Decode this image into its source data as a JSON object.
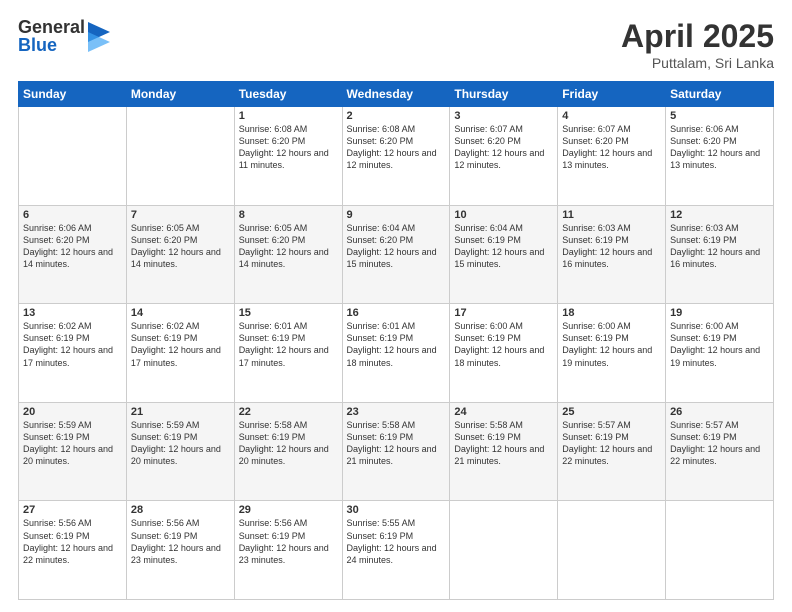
{
  "logo": {
    "general": "General",
    "blue": "Blue"
  },
  "title": {
    "month_year": "April 2025",
    "location": "Puttalam, Sri Lanka"
  },
  "headers": [
    "Sunday",
    "Monday",
    "Tuesday",
    "Wednesday",
    "Thursday",
    "Friday",
    "Saturday"
  ],
  "weeks": [
    [
      {
        "day": "",
        "info": ""
      },
      {
        "day": "",
        "info": ""
      },
      {
        "day": "1",
        "info": "Sunrise: 6:08 AM\nSunset: 6:20 PM\nDaylight: 12 hours and 11 minutes."
      },
      {
        "day": "2",
        "info": "Sunrise: 6:08 AM\nSunset: 6:20 PM\nDaylight: 12 hours and 12 minutes."
      },
      {
        "day": "3",
        "info": "Sunrise: 6:07 AM\nSunset: 6:20 PM\nDaylight: 12 hours and 12 minutes."
      },
      {
        "day": "4",
        "info": "Sunrise: 6:07 AM\nSunset: 6:20 PM\nDaylight: 12 hours and 13 minutes."
      },
      {
        "day": "5",
        "info": "Sunrise: 6:06 AM\nSunset: 6:20 PM\nDaylight: 12 hours and 13 minutes."
      }
    ],
    [
      {
        "day": "6",
        "info": "Sunrise: 6:06 AM\nSunset: 6:20 PM\nDaylight: 12 hours and 14 minutes."
      },
      {
        "day": "7",
        "info": "Sunrise: 6:05 AM\nSunset: 6:20 PM\nDaylight: 12 hours and 14 minutes."
      },
      {
        "day": "8",
        "info": "Sunrise: 6:05 AM\nSunset: 6:20 PM\nDaylight: 12 hours and 14 minutes."
      },
      {
        "day": "9",
        "info": "Sunrise: 6:04 AM\nSunset: 6:20 PM\nDaylight: 12 hours and 15 minutes."
      },
      {
        "day": "10",
        "info": "Sunrise: 6:04 AM\nSunset: 6:19 PM\nDaylight: 12 hours and 15 minutes."
      },
      {
        "day": "11",
        "info": "Sunrise: 6:03 AM\nSunset: 6:19 PM\nDaylight: 12 hours and 16 minutes."
      },
      {
        "day": "12",
        "info": "Sunrise: 6:03 AM\nSunset: 6:19 PM\nDaylight: 12 hours and 16 minutes."
      }
    ],
    [
      {
        "day": "13",
        "info": "Sunrise: 6:02 AM\nSunset: 6:19 PM\nDaylight: 12 hours and 17 minutes."
      },
      {
        "day": "14",
        "info": "Sunrise: 6:02 AM\nSunset: 6:19 PM\nDaylight: 12 hours and 17 minutes."
      },
      {
        "day": "15",
        "info": "Sunrise: 6:01 AM\nSunset: 6:19 PM\nDaylight: 12 hours and 17 minutes."
      },
      {
        "day": "16",
        "info": "Sunrise: 6:01 AM\nSunset: 6:19 PM\nDaylight: 12 hours and 18 minutes."
      },
      {
        "day": "17",
        "info": "Sunrise: 6:00 AM\nSunset: 6:19 PM\nDaylight: 12 hours and 18 minutes."
      },
      {
        "day": "18",
        "info": "Sunrise: 6:00 AM\nSunset: 6:19 PM\nDaylight: 12 hours and 19 minutes."
      },
      {
        "day": "19",
        "info": "Sunrise: 6:00 AM\nSunset: 6:19 PM\nDaylight: 12 hours and 19 minutes."
      }
    ],
    [
      {
        "day": "20",
        "info": "Sunrise: 5:59 AM\nSunset: 6:19 PM\nDaylight: 12 hours and 20 minutes."
      },
      {
        "day": "21",
        "info": "Sunrise: 5:59 AM\nSunset: 6:19 PM\nDaylight: 12 hours and 20 minutes."
      },
      {
        "day": "22",
        "info": "Sunrise: 5:58 AM\nSunset: 6:19 PM\nDaylight: 12 hours and 20 minutes."
      },
      {
        "day": "23",
        "info": "Sunrise: 5:58 AM\nSunset: 6:19 PM\nDaylight: 12 hours and 21 minutes."
      },
      {
        "day": "24",
        "info": "Sunrise: 5:58 AM\nSunset: 6:19 PM\nDaylight: 12 hours and 21 minutes."
      },
      {
        "day": "25",
        "info": "Sunrise: 5:57 AM\nSunset: 6:19 PM\nDaylight: 12 hours and 22 minutes."
      },
      {
        "day": "26",
        "info": "Sunrise: 5:57 AM\nSunset: 6:19 PM\nDaylight: 12 hours and 22 minutes."
      }
    ],
    [
      {
        "day": "27",
        "info": "Sunrise: 5:56 AM\nSunset: 6:19 PM\nDaylight: 12 hours and 22 minutes."
      },
      {
        "day": "28",
        "info": "Sunrise: 5:56 AM\nSunset: 6:19 PM\nDaylight: 12 hours and 23 minutes."
      },
      {
        "day": "29",
        "info": "Sunrise: 5:56 AM\nSunset: 6:19 PM\nDaylight: 12 hours and 23 minutes."
      },
      {
        "day": "30",
        "info": "Sunrise: 5:55 AM\nSunset: 6:19 PM\nDaylight: 12 hours and 24 minutes."
      },
      {
        "day": "",
        "info": ""
      },
      {
        "day": "",
        "info": ""
      },
      {
        "day": "",
        "info": ""
      }
    ]
  ]
}
